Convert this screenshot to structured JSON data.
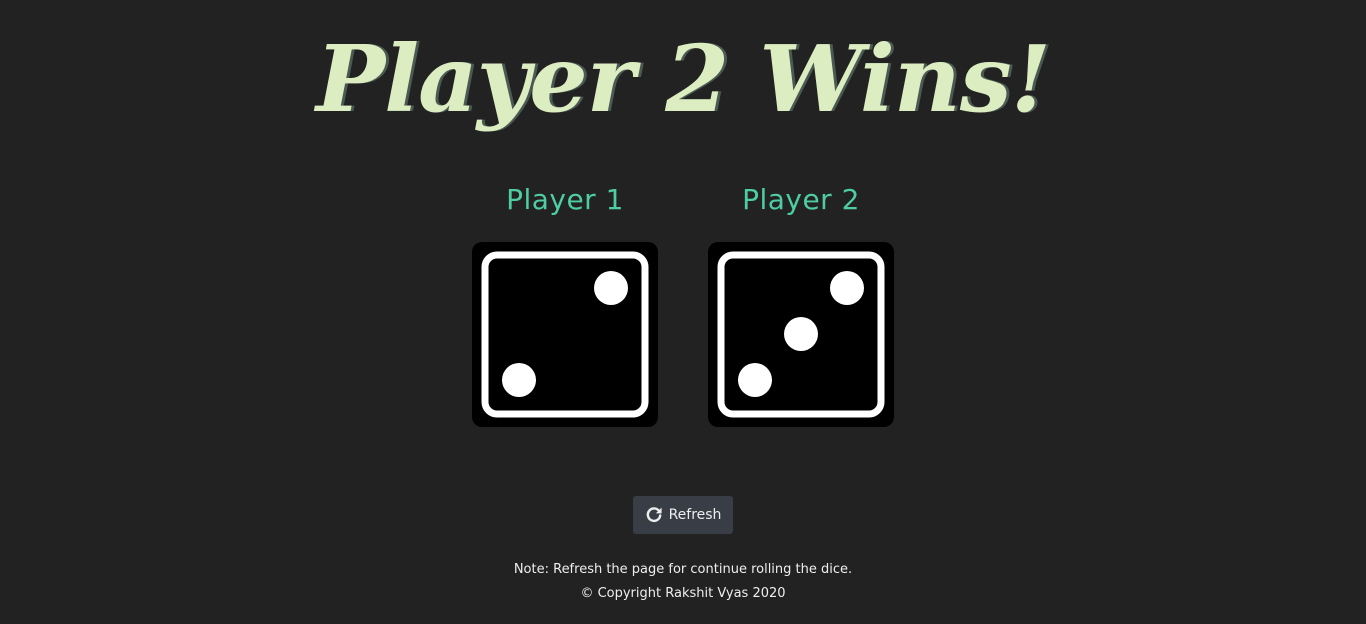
{
  "title": "Player 2 Wins!",
  "players": [
    {
      "label": "Player 1",
      "die_value": 2
    },
    {
      "label": "Player 2",
      "die_value": 3
    }
  ],
  "refresh_button": {
    "label": "Refresh",
    "icon": "refresh-icon"
  },
  "footer": {
    "note": "Note: Refresh the page for continue rolling the dice.",
    "copyright": "© Copyright Rakshit Vyas 2020"
  },
  "colors": {
    "background": "#222222",
    "title": "#dbedc1",
    "player_label": "#4ecca3",
    "button_bg": "#393e46",
    "die_face": "#000000",
    "die_pip": "#ffffff"
  }
}
